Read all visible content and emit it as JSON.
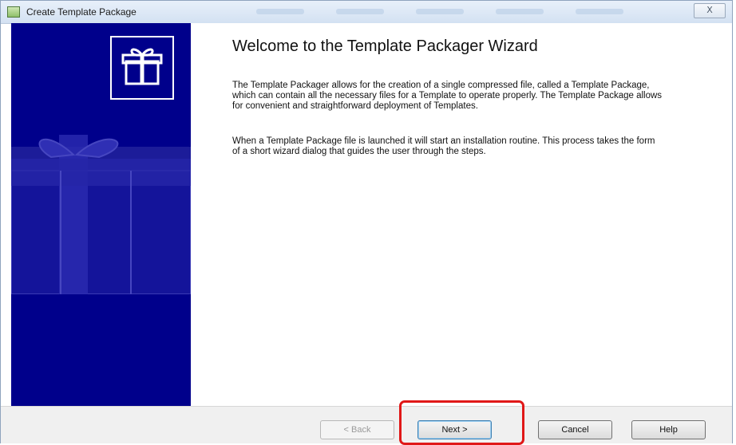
{
  "window": {
    "title": "Create Template Package",
    "close_label": "X"
  },
  "content": {
    "heading": "Welcome to the Template Packager Wizard",
    "paragraphs": [
      "The Template Packager allows for the creation of a single compressed file, called a Template Package, which can contain all the necessary files for a Template to operate properly.  The Template Package allows for convenient and straightforward deployment of Templates.",
      "When a Template Package file is launched it will start an installation routine. This process takes the form of a short wizard dialog that guides the user through the steps."
    ]
  },
  "buttons": {
    "back": "< Back",
    "next": "Next >",
    "cancel": "Cancel",
    "help": "Help"
  },
  "colors": {
    "sidebar": "#00008b",
    "highlight": "#e01818"
  },
  "icons": {
    "title": "package-icon",
    "logo": "gift-box-icon",
    "watermark": "gift-box-watermark-icon"
  }
}
